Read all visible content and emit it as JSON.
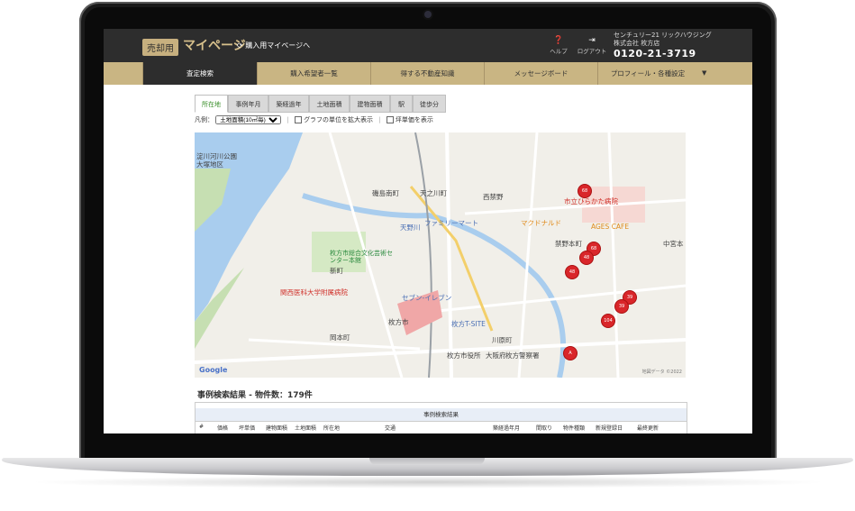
{
  "header": {
    "mode_badge": "売却用",
    "title": "マイページ",
    "buy_link": "購入用マイページへ",
    "help_label": "ヘルプ",
    "logout_label": "ログアウト",
    "company_line1": "センチュリー21 リックハウジング",
    "company_line2": "株式会社 枚方店",
    "phone": "0120-21-3719"
  },
  "nav": {
    "items": [
      {
        "label": "査定検索"
      },
      {
        "label": "購入希望者一覧"
      },
      {
        "label": "得する不動産知識"
      },
      {
        "label": "メッセージボード"
      },
      {
        "label": "プロフィール・各種設定"
      }
    ]
  },
  "tabs": [
    {
      "label": "所在地"
    },
    {
      "label": "事例年月"
    },
    {
      "label": "築経過年"
    },
    {
      "label": "土地面積"
    },
    {
      "label": "建物面積"
    },
    {
      "label": "駅"
    },
    {
      "label": "徒歩分"
    }
  ],
  "legend": {
    "label": "凡例：",
    "select_value": "土地面積(10㎡毎)",
    "check1": "グラフの単位を拡大表示",
    "check2": "坪単価を表示"
  },
  "map": {
    "labels": {
      "yodogawa": "淀川河川公園 大塚地区",
      "isoshima": "磯島南町",
      "tennogawa": "天之川町",
      "nishikinya": "西禁野",
      "shinmachi": "新町",
      "culture": "枚方市総合文化芸術センター本館",
      "kansai": "関西医科大学附属病院",
      "kinyahon": "禁野本町",
      "hirakata_station": "枚方市",
      "tsite": "枚方T-SITE",
      "okamoto": "岡本町",
      "kawaharacho": "川原町",
      "hospital": "市立ひらかた病院",
      "mcd": "マクドナルド",
      "family": "ファミリーマート",
      "cityhall": "枚方市役所",
      "police": "枚方警察署",
      "nakamiya": "中宮本",
      "osakafu": "大阪府",
      "ages": "AGES CAFE",
      "seven": "セブン-イレブン",
      "keihan": "天野川"
    },
    "attribution": "地図データ ©2022",
    "pins": [
      "68",
      "68",
      "48",
      "48",
      "39",
      "39",
      "104",
      "A"
    ]
  },
  "results": {
    "title": "事例検索結果 - 物件数：179件",
    "caption": "事例検索結果",
    "columns": [
      "#",
      "価格",
      "坪単価",
      "建物面積",
      "土地面積",
      "所在地",
      "交通",
      "築経過年月",
      "間取り",
      "物件種類",
      "新規登録日",
      "最終更新"
    ]
  }
}
